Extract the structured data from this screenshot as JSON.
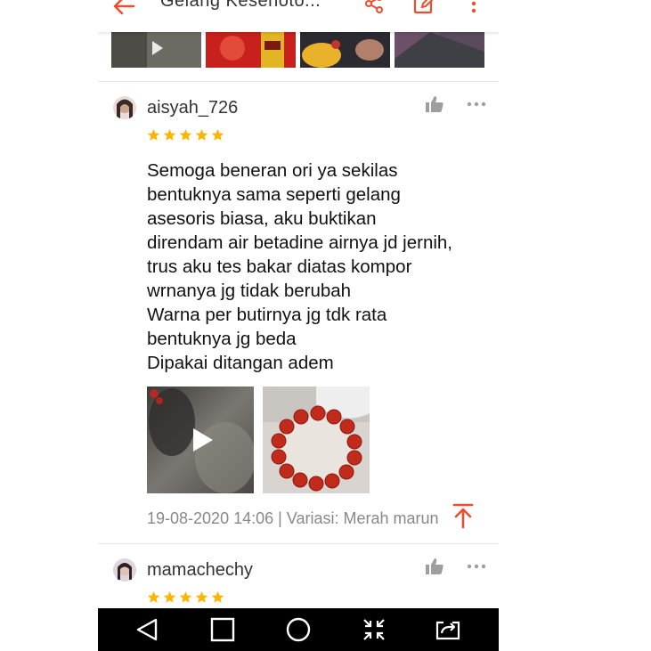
{
  "app": {
    "title": "Gelang Kesehoto..."
  },
  "reviews": [
    {
      "username": "aisyah_726",
      "rating": 5,
      "text": "Semoga beneran ori ya sekilas\nbentuknya sama seperti gelang\nasesoris biasa, aku buktikan\ndirendam air betadine airnya jd jernih,\ntrus aku tes bakar diatas kompor\nwrnanya jg tidak berubah\nWarna per butirnya jg tdk rata\nbentuknya jg beda\nDipakai ditangan adem",
      "meta": "19-08-2020 14:06 | Variasi: Merah marun"
    },
    {
      "username": "mamachechy",
      "rating": 5
    }
  ],
  "colors": {
    "accent": "#ee4d2d",
    "star": "#ffb400",
    "navbar": "#000000"
  },
  "icons": {
    "back": "arrow-left-icon",
    "share": "share-icon",
    "edit": "edit-icon",
    "more": "more-vertical-icon",
    "like": "thumbs-up-icon",
    "review_more": "more-horizontal-icon",
    "play": "play-icon",
    "scroll_top": "arrow-up-to-top-icon",
    "nav": [
      "back-triangle-icon",
      "home-square-icon",
      "recents-circle-icon",
      "shrink-icon",
      "screen-switch-icon"
    ]
  }
}
